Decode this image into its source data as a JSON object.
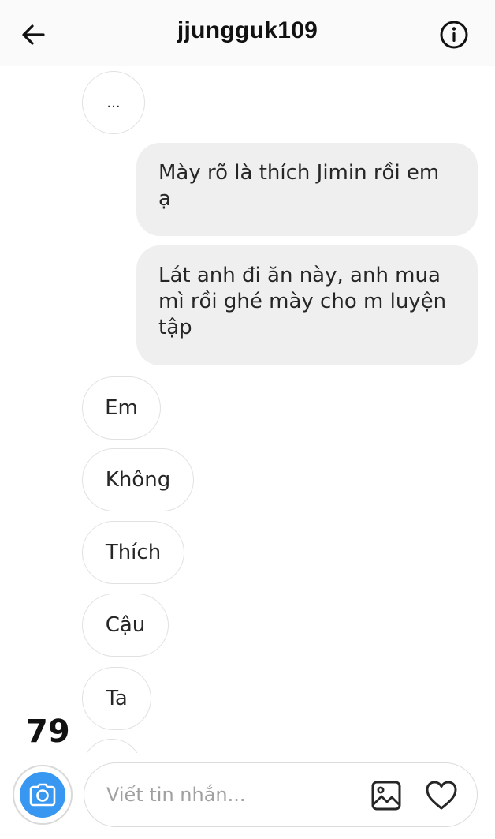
{
  "header": {
    "title": "jjungguk109",
    "back_icon": "arrow-left-icon",
    "info_icon": "info-circle-icon"
  },
  "messages": [
    {
      "direction": "incoming",
      "text": "..."
    },
    {
      "direction": "outgoing",
      "lines": [
        "Mày rõ là thích Jimin rồi em",
        "ạ"
      ]
    },
    {
      "direction": "outgoing",
      "lines": [
        "Lát anh đi ăn này, anh mua",
        "mì rồi ghé mày cho m luyện",
        "tập"
      ]
    },
    {
      "direction": "incoming",
      "text": "Em"
    },
    {
      "direction": "incoming",
      "text": "Không"
    },
    {
      "direction": "incoming",
      "text": "Thích"
    },
    {
      "direction": "incoming",
      "text": "Cậu"
    },
    {
      "direction": "incoming",
      "text": "Ta"
    }
  ],
  "overlay": {
    "counter": "79"
  },
  "composer": {
    "placeholder": "Viết tin nhắn...",
    "camera_icon": "camera-icon",
    "gallery_icon": "image-gallery-icon",
    "heart_icon": "heart-icon"
  },
  "colors": {
    "accent": "#3897f0",
    "outgoing_bubble": "#efefef",
    "incoming_border": "#e1e1e1"
  }
}
